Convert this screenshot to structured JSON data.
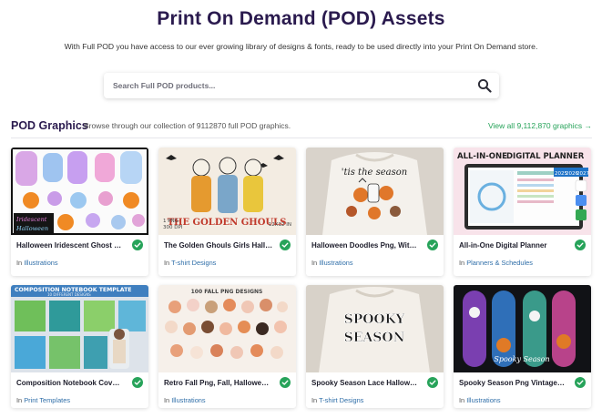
{
  "header": {
    "title": "Print On Demand (POD) Assets",
    "subtitle": "With Full POD you have access to our ever growing library of designs & fonts, ready to be used directly into your Print On Demand store."
  },
  "search": {
    "placeholder": "Search Full POD products...",
    "icon": "search-icon"
  },
  "section": {
    "title": "POD Graphics",
    "description": "Browse through our collection of 9112870 full POD graphics.",
    "view_all": "View all 9,112,870 graphics",
    "view_all_icon": "arrow-right-icon"
  },
  "colors": {
    "brand": "#2a1a4e",
    "accent_green": "#27a35a",
    "link_blue": "#2f6ea8"
  },
  "products": [
    {
      "title": "Halloween Iridescent Ghost …",
      "in": "In",
      "category": "Illustrations",
      "thumb_text": [
        "Iridescent",
        "Halloween"
      ]
    },
    {
      "title": "The Golden Ghouls Girls Hall…",
      "in": "In",
      "category": "T-shirt Designs",
      "thumb_text": [
        "THE GOLDEN GHOULS",
        "1 PNG",
        "300 DPI",
        "12X12 IN"
      ]
    },
    {
      "title": "Halloween Doodles Png, Wit…",
      "in": "In",
      "category": "Illustrations",
      "thumb_text": [
        "'tis the season"
      ]
    },
    {
      "title": "All-in-One Digital Planner",
      "in": "In",
      "category": "Planners & Schedules",
      "thumb_text": [
        "ALL-IN-ONE",
        "DIGITAL PLANNER",
        "2025",
        "2026",
        "2027"
      ]
    },
    {
      "title": "Composition Notebook Cov…",
      "in": "In",
      "category": "Print Templates",
      "thumb_text": [
        "COMPOSITION NOTEBOOK TEMPLATE",
        "10 DIFFERENT DESIGNS"
      ]
    },
    {
      "title": "Retro Fall Png, Fall, Hallowe…",
      "in": "In",
      "category": "Illustrations",
      "thumb_text": [
        "100 FALL PNG DESIGNS"
      ]
    },
    {
      "title": "Spooky Season Lace Hallow…",
      "in": "In",
      "category": "T-shirt Designs",
      "thumb_text": [
        "SPOOKY",
        "SEASON"
      ]
    },
    {
      "title": "Spooky Season Png Vintage…",
      "in": "In",
      "category": "Illustrations",
      "thumb_text": [
        "Spooky Season"
      ]
    }
  ]
}
